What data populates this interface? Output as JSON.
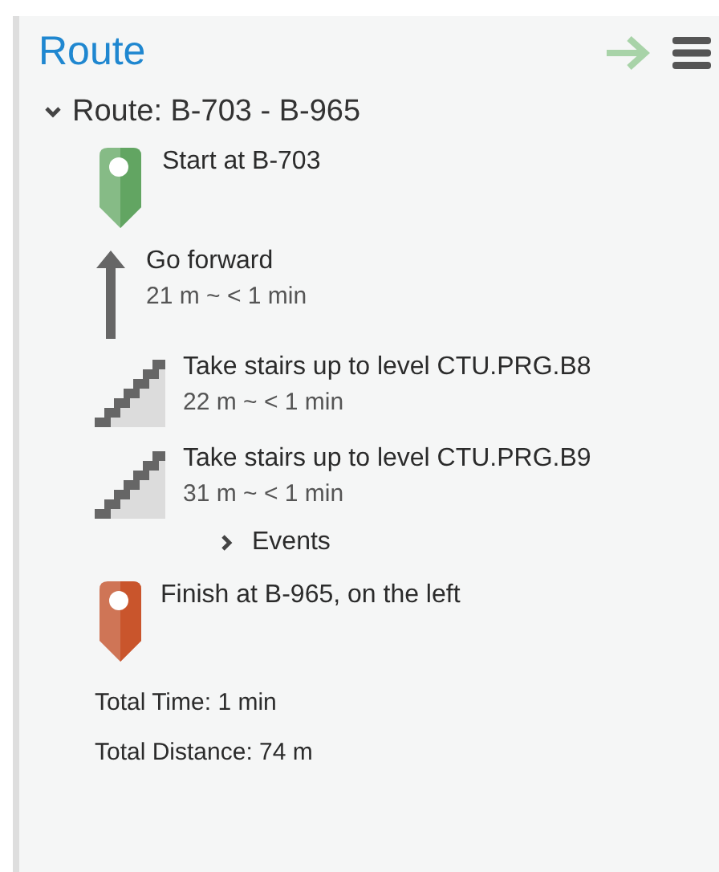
{
  "panel": {
    "title": "Route"
  },
  "route": {
    "label": "Route: B-703 - B-965",
    "expanded": true,
    "steps": [
      {
        "kind": "start",
        "text": "Start at B-703"
      },
      {
        "kind": "forward",
        "text": "Go forward",
        "detail": "21 m ~ < 1 min"
      },
      {
        "kind": "stairs",
        "text": "Take stairs up to level CTU.PRG.B8",
        "detail": "22 m ~ < 1 min"
      },
      {
        "kind": "stairs",
        "text": "Take stairs up to level CTU.PRG.B9",
        "detail": "31 m ~ < 1 min",
        "events": {
          "label": "Events",
          "expanded": false
        }
      },
      {
        "kind": "finish",
        "text": "Finish at B-965, on the left"
      }
    ]
  },
  "totals": [
    "Total Time: 1 min",
    "Total Distance: 74 m"
  ]
}
